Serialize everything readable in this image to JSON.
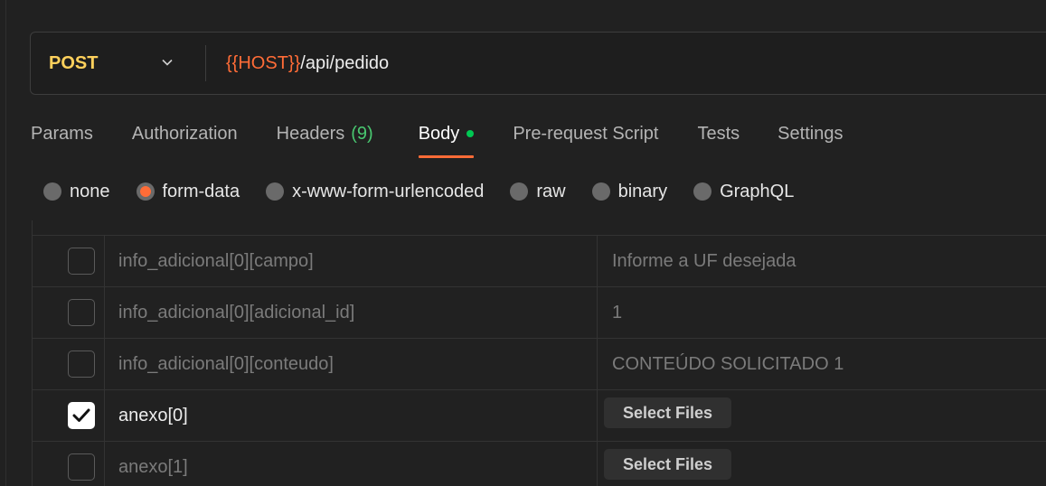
{
  "request": {
    "method": "POST",
    "url_variable": "{{HOST}}",
    "url_path": "/api/pedido"
  },
  "tabs": [
    {
      "label": "Params"
    },
    {
      "label": "Authorization"
    },
    {
      "label": "Headers",
      "count": "(9)"
    },
    {
      "label": "Body",
      "active": true,
      "indicator": "green-dot"
    },
    {
      "label": "Pre-request Script"
    },
    {
      "label": "Tests"
    },
    {
      "label": "Settings"
    }
  ],
  "body_types": [
    {
      "label": "none",
      "selected": false
    },
    {
      "label": "form-data",
      "selected": true
    },
    {
      "label": "x-www-form-urlencoded",
      "selected": false
    },
    {
      "label": "raw",
      "selected": false
    },
    {
      "label": "binary",
      "selected": false
    },
    {
      "label": "GraphQL",
      "selected": false
    }
  ],
  "form_rows": [
    {
      "checked": false,
      "key": "info_adicional[0][campo]",
      "value": "Informe a UF desejada",
      "type": "text"
    },
    {
      "checked": false,
      "key": "info_adicional[0][adicional_id]",
      "value": "1",
      "type": "text"
    },
    {
      "checked": false,
      "key": "info_adicional[0][conteudo]",
      "value": "CONTEÚDO SOLICITADO 1",
      "type": "text"
    },
    {
      "checked": true,
      "key": "anexo[0]",
      "value": "Select Files",
      "type": "file"
    },
    {
      "checked": false,
      "key": "anexo[1]",
      "value": "Select Files",
      "type": "file"
    }
  ],
  "colors": {
    "accent": "#ff6c37",
    "method": "#ffd15c",
    "count": "#49c770",
    "indicator": "#00c853"
  },
  "icons": {
    "method_dropdown": "chevron-down-icon",
    "checkbox_checked": "check-icon"
  }
}
